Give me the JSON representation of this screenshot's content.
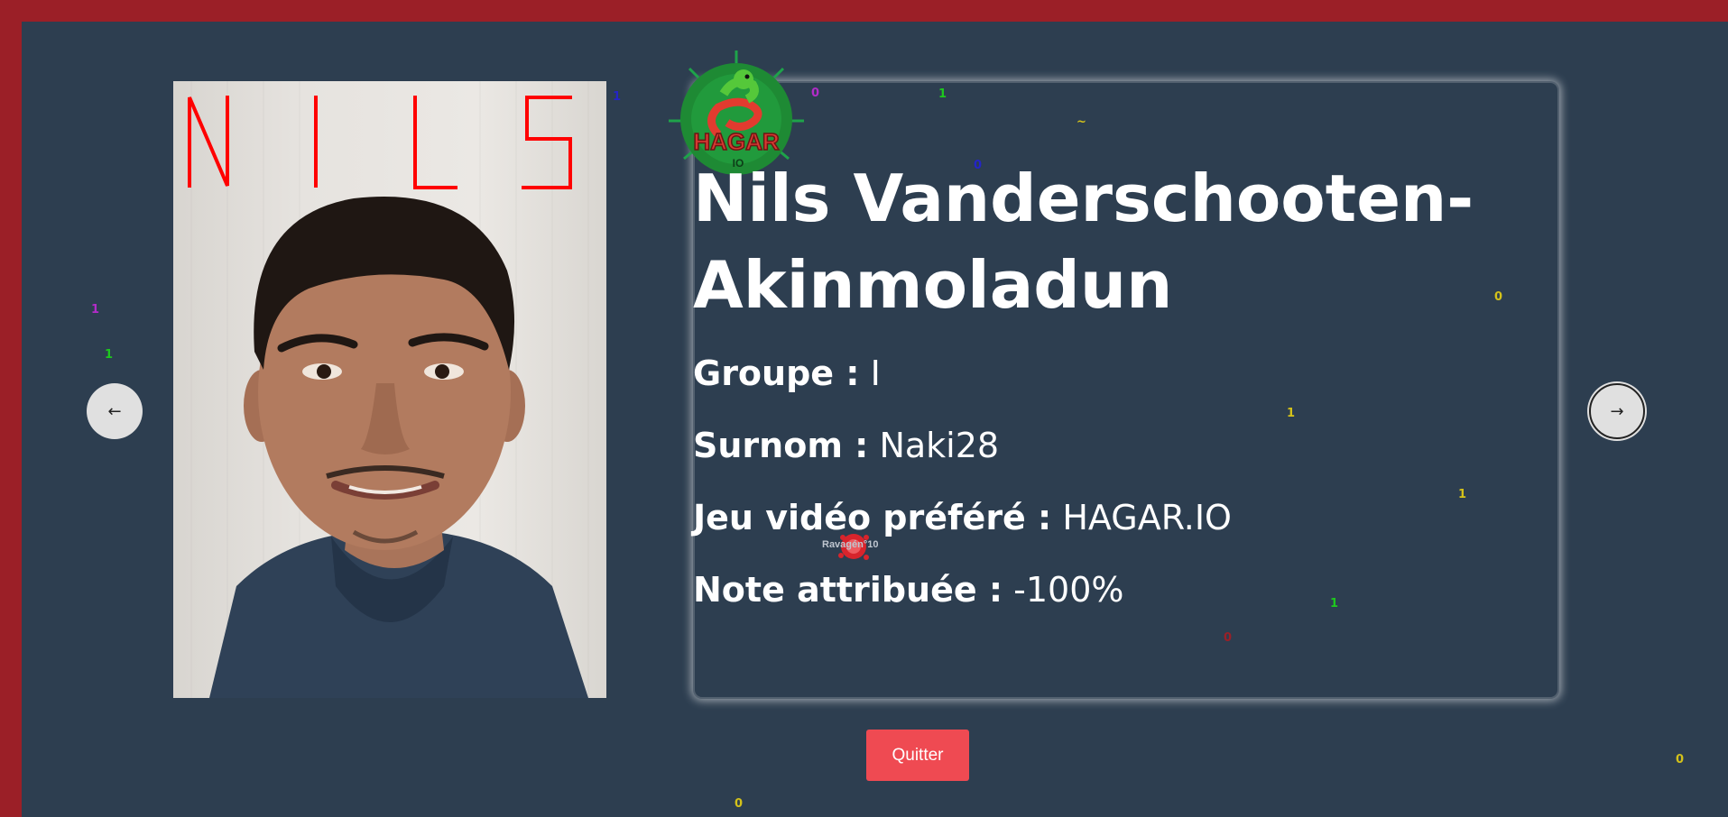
{
  "profile": {
    "name_line1": "Nils Vanderschooten-",
    "name_line2": "Akinmoladun",
    "photo_caption": "NILS",
    "fields": {
      "groupe_label": "Groupe :",
      "groupe_value": "I",
      "surnom_label": "Surnom :",
      "surnom_value": "Naki28",
      "jeu_label": "Jeu vidéo préféré :",
      "jeu_value": "HAGAR.IO",
      "note_label": "Note attribuée :",
      "note_value": "-100%"
    }
  },
  "navigation": {
    "prev_label": "←",
    "next_label": "→",
    "quit_label": "Quitter"
  },
  "logo": {
    "text": "HAGAR",
    "subtext": "IO",
    "icon": "snake-logo-icon"
  },
  "game_overlay": {
    "player_name": "Ravagén°10",
    "bits": [
      {
        "text": "1",
        "color": "#2424c8"
      },
      {
        "text": "0",
        "color": "#b22cc8"
      },
      {
        "text": "1",
        "color": "#1ec81e"
      },
      {
        "text": "~",
        "color": "#d4c21a"
      },
      {
        "text": "0",
        "color": "#2424c8"
      },
      {
        "text": "0",
        "color": "#d4c21a"
      },
      {
        "text": "1",
        "color": "#b22cc8"
      },
      {
        "text": "1",
        "color": "#1ec81e"
      },
      {
        "text": "1",
        "color": "#d4c21a"
      },
      {
        "text": "1",
        "color": "#d4c21a"
      },
      {
        "text": "1",
        "color": "#1ec81e"
      },
      {
        "text": "0",
        "color": "#9b1f27"
      },
      {
        "text": "0",
        "color": "#d4c21a"
      },
      {
        "text": "0",
        "color": "#d4c21a"
      }
    ]
  },
  "colors": {
    "background": "#2d3e50",
    "frame": "#9b1f27",
    "quit_button": "#ef4a52",
    "caption": "#ff0000"
  }
}
